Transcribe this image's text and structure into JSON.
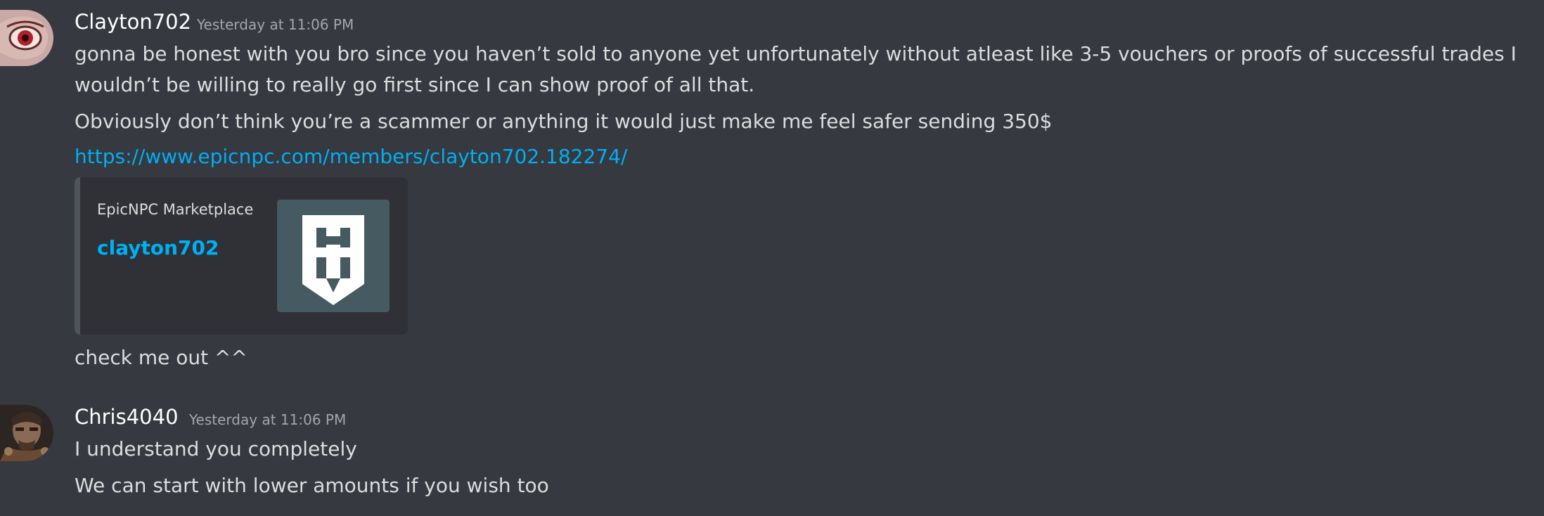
{
  "messages": [
    {
      "username": "Clayton702",
      "timestamp": "Yesterday at 11:06 PM",
      "avatar_icon": "eye-avatar",
      "lines": [
        "gonna be honest with you bro since you haven’t sold to anyone yet unfortunately without atleast like 3-5 vouchers or proofs of successful trades I",
        "wouldn’t be willing to really go first since I can show proof of all that.",
        "Obviously don’t think you’re a scammer or anything it would just make me feel safer sending 350$"
      ],
      "link": "https://www.epicnpc.com/members/clayton702.182274/",
      "embed": {
        "provider": "EpicNPC Marketplace",
        "title": "clayton702",
        "thumbnail_icon": "epicnpc-logo"
      },
      "after_embed": "check me out ^^"
    },
    {
      "username": "Chris4040",
      "timestamp": "Yesterday at 11:06 PM",
      "avatar_icon": "character-avatar",
      "lines": [
        "I understand you completely",
        "We can start with lower amounts if you wish too"
      ]
    }
  ],
  "colors": {
    "background": "#36393f",
    "text": "#dcddde",
    "username": "#ffffff",
    "timestamp": "#a3a6aa",
    "link": "#00aff4",
    "embed_bg": "#2f3136",
    "embed_border": "#4f545c",
    "thumb_bg": "#465a61"
  }
}
